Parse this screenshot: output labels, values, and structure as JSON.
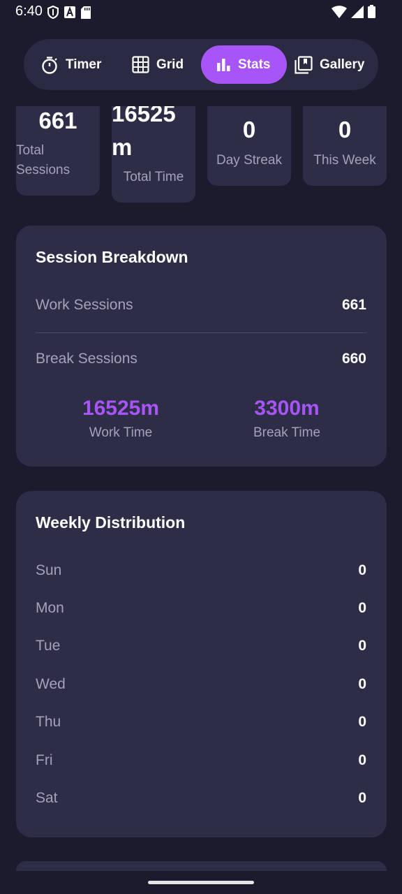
{
  "status_bar": {
    "time": "6:40",
    "left_icons": [
      "shield-icon",
      "text-a-icon",
      "sd-card-icon"
    ],
    "right_icons": [
      "wifi-icon",
      "signal-icon",
      "battery-icon"
    ]
  },
  "nav": {
    "tabs": [
      {
        "label": "Timer",
        "icon": "timer-icon",
        "active": false
      },
      {
        "label": "Grid",
        "icon": "grid-icon",
        "active": false
      },
      {
        "label": "Stats",
        "icon": "bar-chart-icon",
        "active": true
      },
      {
        "label": "Gallery",
        "icon": "gallery-icon",
        "active": false
      }
    ]
  },
  "summary_cards": [
    {
      "value": "661",
      "label_line1": "Total",
      "label_line2": "Sessions"
    },
    {
      "value_line1": "16525",
      "value_line2": "m",
      "label": "Total Time"
    },
    {
      "value": "0",
      "label": "Day Streak"
    },
    {
      "value": "0",
      "label": "This Week"
    }
  ],
  "session_breakdown": {
    "title": "Session Breakdown",
    "rows": [
      {
        "label": "Work Sessions",
        "value": "661"
      },
      {
        "label": "Break Sessions",
        "value": "660"
      }
    ],
    "work_time": {
      "value": "16525m",
      "label": "Work Time"
    },
    "break_time": {
      "value": "3300m",
      "label": "Break Time"
    }
  },
  "weekly_distribution": {
    "title": "Weekly Distribution",
    "days": [
      {
        "label": "Sun",
        "value": "0"
      },
      {
        "label": "Mon",
        "value": "0"
      },
      {
        "label": "Tue",
        "value": "0"
      },
      {
        "label": "Wed",
        "value": "0"
      },
      {
        "label": "Thu",
        "value": "0"
      },
      {
        "label": "Fri",
        "value": "0"
      },
      {
        "label": "Sat",
        "value": "0"
      }
    ]
  },
  "colors": {
    "background": "#1c1b2e",
    "card": "#2e2d48",
    "accent": "#a855f7",
    "muted_text": "#a3a2b7"
  }
}
